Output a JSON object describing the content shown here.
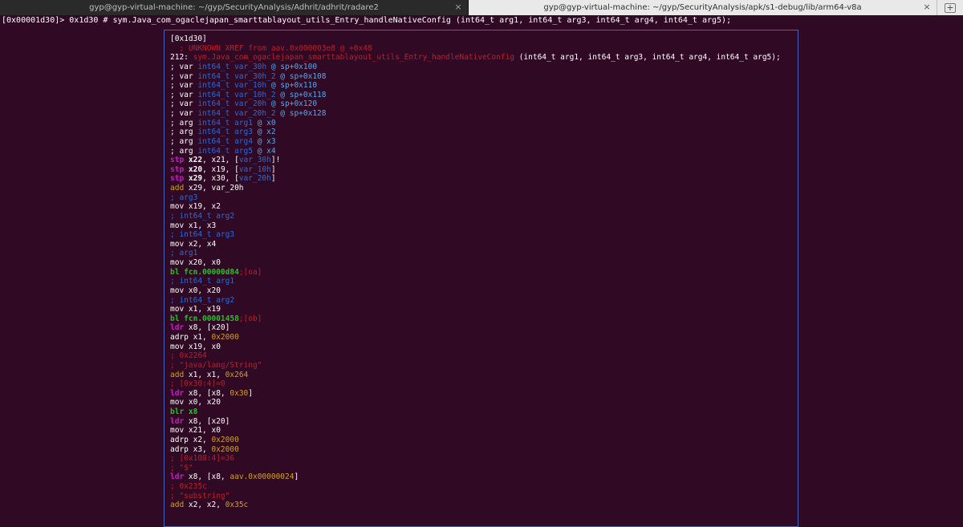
{
  "tabs": [
    {
      "title": "gyp@gyp-virtual-machine: ~/gyp/SecurityAnalysis/Adhrit/adhrit/radare2",
      "active": false
    },
    {
      "title": "gyp@gyp-virtual-machine: ~/gyp/SecurityAnalysis/apk/s1-debug/lib/arm64-v8a",
      "active": true
    }
  ],
  "tab_close_glyph": "×",
  "newtab_glyph": "+",
  "prompt": "[0x00001d30]> 0x1d30 # sym.Java_com_ogaclejapan_smarttablayout_utils_Entry_handleNativeConfig (int64_t arg1, int64_t arg3, int64_t arg4, int64_t arg5);",
  "colors": {
    "background": "#300a24",
    "white": "#ffffff",
    "red": "#c01c28",
    "blue": "#2a6ad9",
    "cyan": "#58a8e8",
    "magenta": "#c021c0",
    "green": "#26c026",
    "yellow": "#d4a017",
    "box_border": "#4a5fc1"
  },
  "disasm": [
    [
      {
        "t": "[0x1d30]",
        "c": "w"
      }
    ],
    [
      {
        "t": "  ; UNKNOWN XREF from aav.0x000003e8 @ +0x48",
        "c": "red"
      }
    ],
    [
      {
        "t": "212: ",
        "c": "w"
      },
      {
        "t": "sym.Java_com_ogaclejapan_smarttablayout_utils_Entry_handleNativeConfig",
        "c": "red"
      },
      {
        "t": " (int64_t arg1, int64_t arg3, int64_t arg4, int64_t arg5);",
        "c": "w"
      }
    ],
    [
      {
        "t": "; var ",
        "c": "w"
      },
      {
        "t": "int64_t var_30h",
        "c": "blue"
      },
      {
        "t": " @ sp+0x100",
        "c": "cyan"
      }
    ],
    [
      {
        "t": "; var ",
        "c": "w"
      },
      {
        "t": "int64_t var_30h_2",
        "c": "blue"
      },
      {
        "t": " @ sp+0x108",
        "c": "cyan"
      }
    ],
    [
      {
        "t": "; var ",
        "c": "w"
      },
      {
        "t": "int64_t var_10h",
        "c": "blue"
      },
      {
        "t": " @ sp+0x110",
        "c": "cyan"
      }
    ],
    [
      {
        "t": "; var ",
        "c": "w"
      },
      {
        "t": "int64_t var_10h_2",
        "c": "blue"
      },
      {
        "t": " @ sp+0x118",
        "c": "cyan"
      }
    ],
    [
      {
        "t": "; var ",
        "c": "w"
      },
      {
        "t": "int64_t var_20h",
        "c": "blue"
      },
      {
        "t": " @ sp+0x120",
        "c": "cyan"
      }
    ],
    [
      {
        "t": "; var ",
        "c": "w"
      },
      {
        "t": "int64_t var_20h_2",
        "c": "blue"
      },
      {
        "t": " @ sp+0x128",
        "c": "cyan"
      }
    ],
    [
      {
        "t": "; arg ",
        "c": "w"
      },
      {
        "t": "int64_t arg1",
        "c": "blue"
      },
      {
        "t": " @ x0",
        "c": "cyan"
      }
    ],
    [
      {
        "t": "; arg ",
        "c": "w"
      },
      {
        "t": "int64_t arg3",
        "c": "blue"
      },
      {
        "t": " @ x2",
        "c": "cyan"
      }
    ],
    [
      {
        "t": "; arg ",
        "c": "w"
      },
      {
        "t": "int64_t arg4",
        "c": "blue"
      },
      {
        "t": " @ x3",
        "c": "cyan"
      }
    ],
    [
      {
        "t": "; arg ",
        "c": "w"
      },
      {
        "t": "int64_t arg5",
        "c": "blue"
      },
      {
        "t": " @ x4",
        "c": "cyan"
      }
    ],
    [
      {
        "t": "stp ",
        "c": "mag"
      },
      {
        "t": "x22",
        "c": "wb"
      },
      {
        "t": ", x21, [",
        "c": "w"
      },
      {
        "t": "var_30h",
        "c": "blue"
      },
      {
        "t": "]!",
        "c": "w"
      }
    ],
    [
      {
        "t": "stp ",
        "c": "mag"
      },
      {
        "t": "x20",
        "c": "wb"
      },
      {
        "t": ", x19, [",
        "c": "w"
      },
      {
        "t": "var_10h",
        "c": "blue"
      },
      {
        "t": "]",
        "c": "w"
      }
    ],
    [
      {
        "t": "stp ",
        "c": "mag"
      },
      {
        "t": "x29",
        "c": "wb"
      },
      {
        "t": ", x30, [",
        "c": "w"
      },
      {
        "t": "var_20h",
        "c": "blue"
      },
      {
        "t": "]",
        "c": "w"
      }
    ],
    [
      {
        "t": "add",
        "c": "yel"
      },
      {
        "t": " x29, var_20h",
        "c": "w"
      }
    ],
    [
      {
        "t": "; arg3",
        "c": "blue"
      }
    ],
    [
      {
        "t": "mov x19, x2",
        "c": "w"
      }
    ],
    [
      {
        "t": "; int64_t arg2",
        "c": "blue"
      }
    ],
    [
      {
        "t": "mov x1, x3",
        "c": "w"
      }
    ],
    [
      {
        "t": "; int64_t arg3",
        "c": "blue"
      }
    ],
    [
      {
        "t": "mov x2, x4",
        "c": "w"
      }
    ],
    [
      {
        "t": "; arg1",
        "c": "blue"
      }
    ],
    [
      {
        "t": "mov x20, x0",
        "c": "w"
      }
    ],
    [
      {
        "t": "bl fcn.00000d84",
        "c": "grn"
      },
      {
        "t": ";[oa]",
        "c": "red"
      }
    ],
    [
      {
        "t": "; int64_t arg1",
        "c": "blue"
      }
    ],
    [
      {
        "t": "mov x0, x20",
        "c": "w"
      }
    ],
    [
      {
        "t": "; int64_t arg2",
        "c": "blue"
      }
    ],
    [
      {
        "t": "mov x1, x19",
        "c": "w"
      }
    ],
    [
      {
        "t": "bl fcn.00001458",
        "c": "grn"
      },
      {
        "t": ";[ob]",
        "c": "red"
      }
    ],
    [
      {
        "t": "ldr",
        "c": "mag"
      },
      {
        "t": " x8, [x20]",
        "c": "w"
      }
    ],
    [
      {
        "t": "adrp x1, ",
        "c": "w"
      },
      {
        "t": "0x2000",
        "c": "yel"
      }
    ],
    [
      {
        "t": "mov x19, x0",
        "c": "w"
      }
    ],
    [
      {
        "t": "; 0x2264",
        "c": "red"
      }
    ],
    [
      {
        "t": "; \"java/lang/String\"",
        "c": "red"
      }
    ],
    [
      {
        "t": "add",
        "c": "yel"
      },
      {
        "t": " x1, x1, ",
        "c": "w"
      },
      {
        "t": "0x264",
        "c": "yel"
      }
    ],
    [
      {
        "t": "; [0x30:4]=0",
        "c": "red"
      }
    ],
    [
      {
        "t": "ldr",
        "c": "mag"
      },
      {
        "t": " x8, [x8, ",
        "c": "w"
      },
      {
        "t": "0x30",
        "c": "yel"
      },
      {
        "t": "]",
        "c": "w"
      }
    ],
    [
      {
        "t": "mov x0, x20",
        "c": "w"
      }
    ],
    [
      {
        "t": "blr x8",
        "c": "grn"
      }
    ],
    [
      {
        "t": "ldr",
        "c": "mag"
      },
      {
        "t": " x8, [x20]",
        "c": "w"
      }
    ],
    [
      {
        "t": "mov x21, x0",
        "c": "w"
      }
    ],
    [
      {
        "t": "adrp x2, ",
        "c": "w"
      },
      {
        "t": "0x2000",
        "c": "yel"
      }
    ],
    [
      {
        "t": "adrp x3, ",
        "c": "w"
      },
      {
        "t": "0x2000",
        "c": "yel"
      }
    ],
    [
      {
        "t": "; [0x108:4]=36",
        "c": "red"
      }
    ],
    [
      {
        "t": "; \"$\"",
        "c": "red"
      }
    ],
    [
      {
        "t": "ldr",
        "c": "mag"
      },
      {
        "t": " x8, [x8, ",
        "c": "w"
      },
      {
        "t": "aav.0x00000024",
        "c": "yel"
      },
      {
        "t": "]",
        "c": "w"
      }
    ],
    [
      {
        "t": "; 0x235c",
        "c": "red"
      }
    ],
    [
      {
        "t": "; \"substring\"",
        "c": "red"
      }
    ],
    [
      {
        "t": "add",
        "c": "yel"
      },
      {
        "t": " x2, x2, ",
        "c": "w"
      },
      {
        "t": "0x35c",
        "c": "yel"
      }
    ]
  ]
}
